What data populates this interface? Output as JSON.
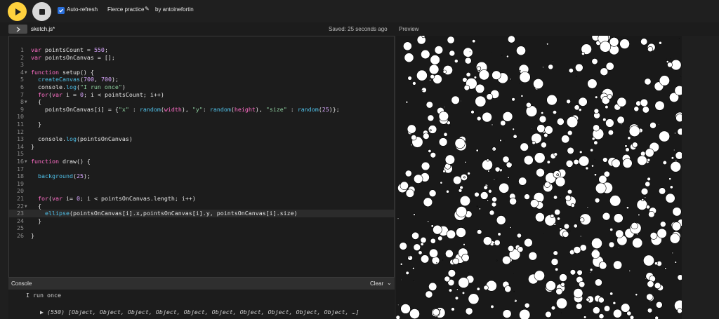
{
  "toolbar": {
    "auto_refresh_label": "Auto-refresh",
    "project_name": "Fierce practice",
    "author": "by antoinefortin",
    "auto_refresh_checked": true
  },
  "editor": {
    "file_name": "sketch.js*",
    "saved_status": "Saved: 25 seconds ago",
    "preview_label": "Preview",
    "active_line": 23,
    "lines": [
      "var pointsCount = 550;",
      "var pointsOnCanvas = [];",
      "",
      "function setup() {",
      "  createCanvas(700, 700);",
      "  console.log(\"I run once\")",
      "  for(var i = 0; i < pointsCount; i++)",
      "  {",
      "    pointsOnCanvas[i] = {\"x\" : random(width), \"y\": random(height), \"size\" : random(25)};",
      "",
      "  }",
      "",
      "  console.log(pointsOnCanvas)",
      "}",
      "",
      "function draw() {",
      "",
      "  background(25);",
      "",
      "",
      "  for(var i= 0; i < pointsOnCanvas.length; i++)",
      "  {",
      "    ellipse(pointsOnCanvas[i].x,pointsOnCanvas[i].y, pointsOnCanvas[i].size)",
      "  }",
      "",
      "}"
    ],
    "fold_lines": [
      4,
      8,
      16,
      22
    ]
  },
  "console": {
    "title": "Console",
    "clear_label": "Clear",
    "line1": "I run once",
    "line2": "(550) [Object, Object, Object, Object, Object, Object, Object, Object, Object, Object, …]"
  },
  "preview": {
    "background": "#191919",
    "circle_color": "#ffffff"
  }
}
